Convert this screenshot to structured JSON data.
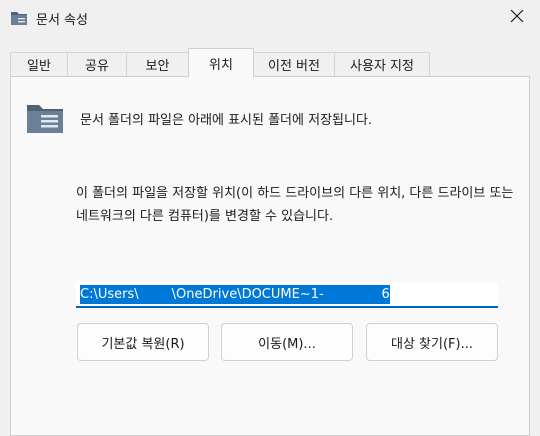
{
  "window": {
    "title": "문서 속성"
  },
  "tabs": [
    {
      "label": "일반"
    },
    {
      "label": "공유"
    },
    {
      "label": "보안"
    },
    {
      "label": "위치",
      "active": true
    },
    {
      "label": "이전 버전"
    },
    {
      "label": "사용자 지정"
    }
  ],
  "location": {
    "header": "문서 폴더의 파일은 아래에 표시된 폴더에 저장됩니다.",
    "description": "이 폴더의 파일을 저장할 위치(이 하드 드라이브의 다른 위치, 다른 드라이브 또는 네트워크의 다른 컴퓨터)를 변경할 수 있습니다.",
    "path_value": "C:\\Users\\        \\OneDrive\\DOCUME~1-              6",
    "buttons": {
      "restore_default": "기본값 복원(R)",
      "move": "이동(M)...",
      "find_target": "대상 찾기(F)..."
    }
  },
  "colors": {
    "accent": "#0067c0",
    "selection": "#0078d7"
  }
}
